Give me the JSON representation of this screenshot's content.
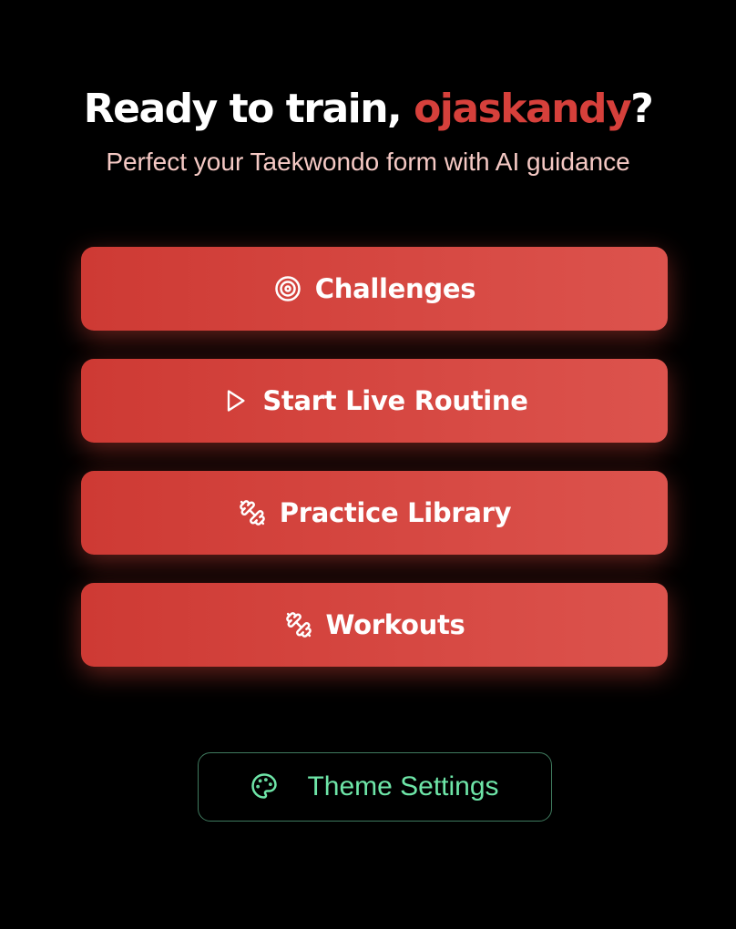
{
  "header": {
    "title_prefix": "Ready to train, ",
    "username": "ojaskandy",
    "title_suffix": "?",
    "subtitle": "Perfect your Taekwondo form with AI guidance"
  },
  "actions": [
    {
      "label": "Challenges",
      "icon": "target-icon"
    },
    {
      "label": "Start Live Routine",
      "icon": "play-icon"
    },
    {
      "label": "Practice Library",
      "icon": "dumbbell-icon"
    },
    {
      "label": "Workouts",
      "icon": "dumbbell-icon"
    }
  ],
  "theme_settings": {
    "label": "Theme Settings",
    "icon": "palette-icon"
  },
  "colors": {
    "background": "#000000",
    "accent_red": "#d6403b",
    "subtitle": "#f5c9c4",
    "theme_green": "#6ee6a8"
  }
}
